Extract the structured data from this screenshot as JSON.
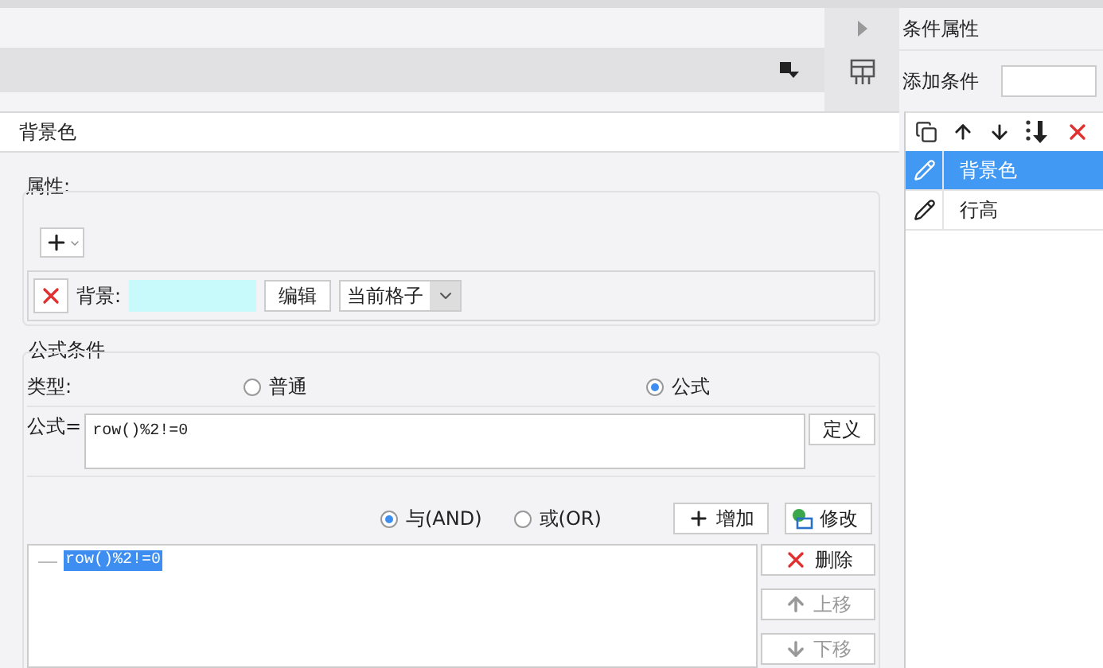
{
  "side_panel": {
    "title": "条件属性",
    "add_condition": {
      "label": "添加条件"
    },
    "conditions": [
      {
        "label": "背景色",
        "selected": true
      },
      {
        "label": "行高",
        "selected": false
      }
    ]
  },
  "dialog": {
    "title": "背景色",
    "attributes": {
      "legend": "属性:",
      "rows": [
        {
          "label": "背景:",
          "color": "#c8fafc",
          "edit_button": "编辑",
          "scope": "当前格子"
        }
      ]
    },
    "formula": {
      "legend": "公式条件",
      "type_label": "类型:",
      "types": [
        {
          "label": "普通",
          "selected": false
        },
        {
          "label": "公式",
          "selected": true
        }
      ],
      "formula_label": "公式=",
      "formula_value": "row()%2!=0",
      "define_button": "定义",
      "joins": [
        {
          "label": "与(AND)",
          "selected": true
        },
        {
          "label": "或(OR)",
          "selected": false
        }
      ],
      "add_button": "增加",
      "modify_button": "修改",
      "conditions": [
        {
          "text": "row()%2!=0",
          "selected": true
        }
      ],
      "side_buttons": [
        {
          "kind": "delete",
          "label": "删除",
          "disabled": false
        },
        {
          "kind": "up",
          "label": "上移",
          "disabled": true
        },
        {
          "kind": "down",
          "label": "下移",
          "disabled": true
        }
      ]
    }
  }
}
